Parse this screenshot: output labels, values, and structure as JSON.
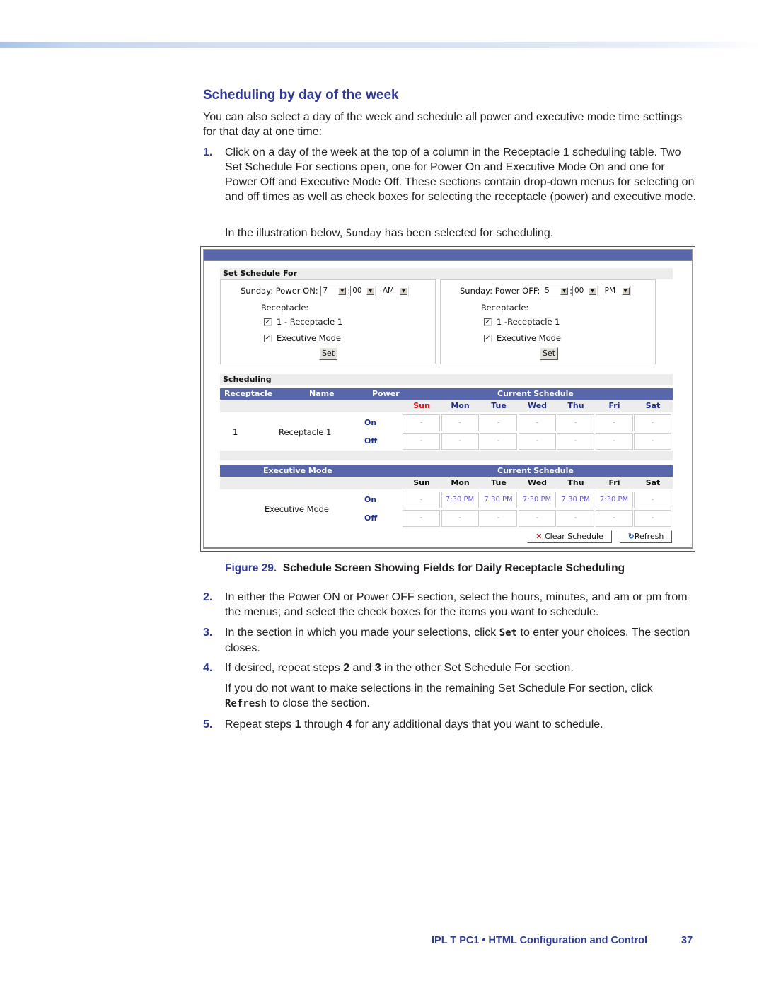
{
  "heading": "Scheduling by day of the week",
  "intro": "You can also select a day of the week and schedule all power and executive mode time settings for that day at one time:",
  "steps": {
    "s1": {
      "num": "1.",
      "text": "Click on a day of the week at the top of a column in the Receptacle 1 scheduling table. Two Set Schedule For sections open, one for Power On and Executive Mode On and one for Power Off and Executive Mode Off. These sections contain drop-down menus for selecting on and off times as well as check boxes for selecting the receptacle (power) and executive mode.",
      "note_pre": "In the illustration below, ",
      "note_code": "Sunday",
      "note_post": " has been selected for scheduling."
    },
    "s2": {
      "num": "2.",
      "text": "In either the Power ON or Power OFF section, select the hours, minutes, and am or pm from the menus; and select the check boxes for the items you want to schedule."
    },
    "s3": {
      "num": "3.",
      "pre": "In the section in which you made your selections, click ",
      "code": "Set",
      "post": " to enter your choices. The section closes."
    },
    "s4": {
      "num": "4.",
      "pre": "If desired, repeat steps ",
      "b1": "2",
      "mid": " and ",
      "b2": "3",
      "post": " in the other Set Schedule For section.",
      "note_pre": "If you do not want to make selections in the remaining Set Schedule For section, click ",
      "note_code": "Refresh",
      "note_post": " to close the section."
    },
    "s5": {
      "num": "5.",
      "pre": "Repeat steps ",
      "b1": "1",
      "mid": " through ",
      "b2": "4",
      "post": " for any additional days that you want to schedule."
    }
  },
  "screenshot": {
    "set_schedule_title": "Set Schedule For",
    "on_panel": {
      "label": "Sunday: Power ON:",
      "hour": "7",
      "minute": "00",
      "ampm": "AM",
      "receptacle_label": "Receptacle:",
      "check1": "1 - Receptacle 1",
      "check2": "Executive Mode",
      "set_label": "Set"
    },
    "off_panel": {
      "label": "Sunday: Power OFF:",
      "hour": "5",
      "minute": "00",
      "ampm": "PM",
      "receptacle_label": "Receptacle:",
      "check1": "1 -Receptacle 1",
      "check2": "Executive Mode",
      "set_label": "Set"
    },
    "checkmark": "✓",
    "dropdown_arrow": "▼",
    "scheduling_title": "Scheduling",
    "receptacle_table": {
      "headers": {
        "receptacle": "Receptacle",
        "name": "Name",
        "power": "Power",
        "current": "Current Schedule"
      },
      "days": [
        "Sun",
        "Mon",
        "Tue",
        "Wed",
        "Thu",
        "Fri",
        "Sat"
      ],
      "selected_day_color": "#e8141b",
      "row": {
        "id": "1",
        "name": "Receptacle 1",
        "on_label": "On",
        "off_label": "Off"
      },
      "on": [
        "-",
        "-",
        "-",
        "-",
        "-",
        "-",
        "-"
      ],
      "off": [
        "-",
        "-",
        "-",
        "-",
        "-",
        "-",
        "-"
      ]
    },
    "exec_table": {
      "headers": {
        "mode": "Executive Mode",
        "current": "Current Schedule"
      },
      "days": [
        "Sun",
        "Mon",
        "Tue",
        "Wed",
        "Thu",
        "Fri",
        "Sat"
      ],
      "row": {
        "name": "Executive Mode",
        "on_label": "On",
        "off_label": "Off"
      },
      "on": [
        "-",
        "7:30 PM",
        "7:30 PM",
        "7:30 PM",
        "7:30 PM",
        "7:30 PM",
        "-"
      ],
      "off": [
        "-",
        "-",
        "-",
        "-",
        "-",
        "-",
        "-"
      ]
    },
    "clear_label": "Clear Schedule",
    "clear_icon": "✕",
    "refresh_label": "Refresh",
    "refresh_icon": "↻",
    "header_color": "#5867a9"
  },
  "caption": {
    "fig": "Figure 29.",
    "text": "Schedule Screen Showing Fields for Daily Receptacle Scheduling"
  },
  "footer": {
    "text": "IPL T PC1 • HTML Configuration and Control",
    "page": "37"
  }
}
